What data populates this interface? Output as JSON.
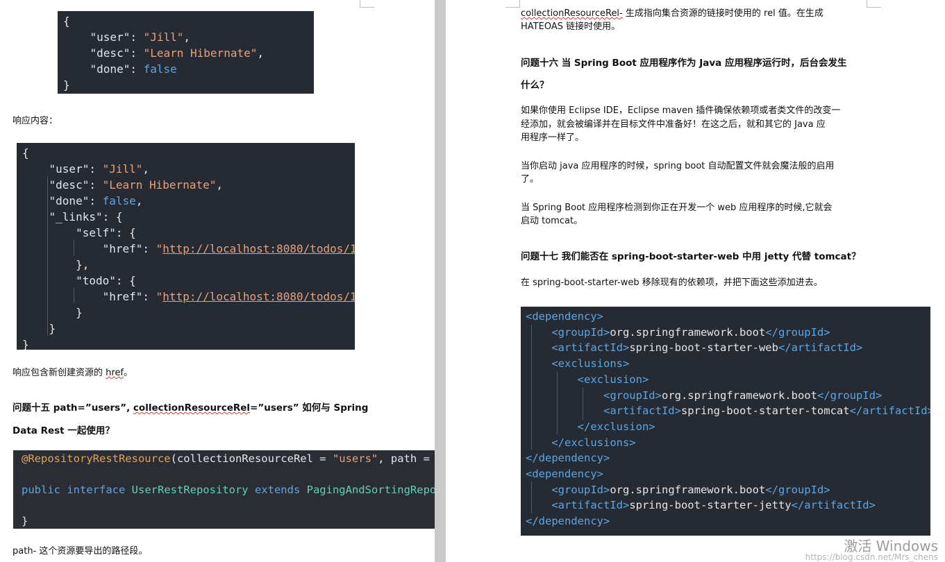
{
  "left": {
    "code1_lines": [
      [
        {
          "t": "{",
          "c": "plain"
        }
      ],
      [
        {
          "t": "    ",
          "c": "plain"
        },
        {
          "t": "\"user\"",
          "c": "key"
        },
        {
          "t": ": ",
          "c": "plain"
        },
        {
          "t": "\"Jill\"",
          "c": "str"
        },
        {
          "t": ",",
          "c": "plain"
        }
      ],
      [
        {
          "t": "    ",
          "c": "plain"
        },
        {
          "t": "\"desc\"",
          "c": "key"
        },
        {
          "t": ": ",
          "c": "plain"
        },
        {
          "t": "\"Learn Hibernate\"",
          "c": "str"
        },
        {
          "t": ",",
          "c": "plain"
        }
      ],
      [
        {
          "t": "    ",
          "c": "plain"
        },
        {
          "t": "\"done\"",
          "c": "key"
        },
        {
          "t": ": ",
          "c": "plain"
        },
        {
          "t": "false",
          "c": "kw"
        }
      ],
      [
        {
          "t": "}",
          "c": "plain"
        }
      ]
    ],
    "response_label": "响应内容：",
    "code2_lines": [
      [
        {
          "t": "{",
          "c": "plain"
        }
      ],
      [
        {
          "t": "    ",
          "c": "plain"
        },
        {
          "t": "\"user\"",
          "c": "key"
        },
        {
          "t": ": ",
          "c": "plain"
        },
        {
          "t": "\"Jill\"",
          "c": "str"
        },
        {
          "t": ",",
          "c": "plain"
        }
      ],
      [
        {
          "t": "    ",
          "c": "plain"
        },
        {
          "t": "\"desc\"",
          "c": "key"
        },
        {
          "t": ": ",
          "c": "plain"
        },
        {
          "t": "\"Learn Hibernate\"",
          "c": "str"
        },
        {
          "t": ",",
          "c": "plain"
        }
      ],
      [
        {
          "t": "    ",
          "c": "plain"
        },
        {
          "t": "\"done\"",
          "c": "key"
        },
        {
          "t": ": ",
          "c": "plain"
        },
        {
          "t": "false",
          "c": "kw"
        },
        {
          "t": ",",
          "c": "plain"
        }
      ],
      [
        {
          "t": "    ",
          "c": "plain"
        },
        {
          "t": "\"_links\"",
          "c": "key"
        },
        {
          "t": ": {",
          "c": "plain"
        }
      ],
      [
        {
          "t": "        ",
          "c": "plain"
        },
        {
          "t": "\"self\"",
          "c": "key"
        },
        {
          "t": ": {",
          "c": "plain"
        }
      ],
      [
        {
          "t": "            ",
          "c": "plain"
        },
        {
          "t": "\"href\"",
          "c": "key"
        },
        {
          "t": ": ",
          "c": "plain"
        },
        {
          "t": "\"",
          "c": "str"
        },
        {
          "t": "http://localhost:8080/todos/1",
          "c": "url"
        },
        {
          "t": "\"",
          "c": "str"
        }
      ],
      [
        {
          "t": "        },",
          "c": "plain"
        }
      ],
      [
        {
          "t": "        ",
          "c": "plain"
        },
        {
          "t": "\"todo\"",
          "c": "key"
        },
        {
          "t": ": {",
          "c": "plain"
        }
      ],
      [
        {
          "t": "            ",
          "c": "plain"
        },
        {
          "t": "\"href\"",
          "c": "key"
        },
        {
          "t": ": ",
          "c": "plain"
        },
        {
          "t": "\"",
          "c": "str"
        },
        {
          "t": "http://localhost:8080/todos/1",
          "c": "url"
        },
        {
          "t": "\"",
          "c": "str"
        }
      ],
      [
        {
          "t": "        }",
          "c": "plain"
        }
      ],
      [
        {
          "t": "    }",
          "c": "plain"
        }
      ],
      [
        {
          "t": "}",
          "c": "plain"
        }
      ]
    ],
    "href_note_prefix": "响应包含新创建资源的 ",
    "href_note_link": "href",
    "href_note_suffix": "。",
    "q15_part1": "问题十五  path=”users”, ",
    "q15_squig": "collectionResourceRel",
    "q15_part2": "=”users”  如何与  Spring",
    "q15_line2": "Data Rest 一起使用？",
    "code3_lines": [
      [
        {
          "t": "@RepositoryRestResource",
          "c": "ann"
        },
        {
          "t": "(collectionResourceRel = ",
          "c": "plain"
        },
        {
          "t": "\"users\"",
          "c": "str"
        },
        {
          "t": ", path = ",
          "c": "plain"
        },
        {
          "t": "\"",
          "c": "str"
        }
      ],
      [
        {
          "t": "",
          "c": "plain"
        }
      ],
      [
        {
          "t": "public ",
          "c": "kw"
        },
        {
          "t": "interface ",
          "c": "kw"
        },
        {
          "t": "UserRestRepository ",
          "c": "cls"
        },
        {
          "t": "extends ",
          "c": "kw"
        },
        {
          "t": "PagingAndSortingRepos",
          "c": "cls"
        }
      ],
      [
        {
          "t": "",
          "c": "plain"
        }
      ],
      [
        {
          "t": "}",
          "c": "plain"
        }
      ]
    ],
    "path_note": "path- 这个资源要导出的路径段。"
  },
  "right": {
    "top_squig": "collectionResourceRel-",
    "top_line1_rest": " 生成指向集合资源的链接时使用的 rel 值。在生成",
    "top_line2": "HATEOAS 链接时使用。",
    "q16_line1": "问题十六  当  Spring Boot 应用程序作为  Java 应用程序运行时，后台会发生",
    "q16_line2": "什么？",
    "para1_lines": [
      "如果你使用 Eclipse IDE，Eclipse maven 插件确保依赖项或者类文件的改变一",
      "经添加，就会被编译并在目标文件中准备好！在这之后，就和其它的 Java 应",
      "用程序一样了。"
    ],
    "para2_lines": [
      "当你启动 java 应用程序的时候，spring boot 自动配置文件就会魔法般的启用",
      "了。"
    ],
    "para3_lines": [
      "当 Spring Boot 应用程序检测到你正在开发一个 web 应用程序的时候,它就会",
      "启动 tomcat。"
    ],
    "q17": "问题十七  我们能否在  spring-boot-starter-web 中用  jetty 代替  tomcat？",
    "para4": "在 spring-boot-starter-web 移除现有的依赖项，并把下面这些添加进去。",
    "xml_lines": [
      [
        {
          "t": "<dependency>",
          "c": "tag"
        }
      ],
      [
        {
          "t": "    ",
          "c": "plain"
        },
        {
          "t": "<groupId>",
          "c": "tag"
        },
        {
          "t": "org.springframework.boot",
          "c": "txt"
        },
        {
          "t": "</groupId>",
          "c": "tag"
        }
      ],
      [
        {
          "t": "    ",
          "c": "plain"
        },
        {
          "t": "<artifactId>",
          "c": "tag"
        },
        {
          "t": "spring-boot-starter-web",
          "c": "txt"
        },
        {
          "t": "</artifactId>",
          "c": "tag"
        }
      ],
      [
        {
          "t": "    ",
          "c": "plain"
        },
        {
          "t": "<exclusions>",
          "c": "tag"
        }
      ],
      [
        {
          "t": "        ",
          "c": "plain"
        },
        {
          "t": "<exclusion>",
          "c": "tag"
        }
      ],
      [
        {
          "t": "            ",
          "c": "plain"
        },
        {
          "t": "<groupId>",
          "c": "tag"
        },
        {
          "t": "org.springframework.boot",
          "c": "txt"
        },
        {
          "t": "</groupId>",
          "c": "tag"
        }
      ],
      [
        {
          "t": "            ",
          "c": "plain"
        },
        {
          "t": "<artifactId>",
          "c": "tag"
        },
        {
          "t": "spring-boot-starter-tomcat",
          "c": "txt"
        },
        {
          "t": "</artifactId>",
          "c": "tag"
        }
      ],
      [
        {
          "t": "        ",
          "c": "plain"
        },
        {
          "t": "</exclusion>",
          "c": "tag"
        }
      ],
      [
        {
          "t": "    ",
          "c": "plain"
        },
        {
          "t": "</exclusions>",
          "c": "tag"
        }
      ],
      [
        {
          "t": "</dependency>",
          "c": "tag"
        }
      ],
      [
        {
          "t": "<dependency>",
          "c": "tag"
        }
      ],
      [
        {
          "t": "    ",
          "c": "plain"
        },
        {
          "t": "<groupId>",
          "c": "tag"
        },
        {
          "t": "org.springframework.boot",
          "c": "txt"
        },
        {
          "t": "</groupId>",
          "c": "tag"
        }
      ],
      [
        {
          "t": "    ",
          "c": "plain"
        },
        {
          "t": "<artifactId>",
          "c": "tag"
        },
        {
          "t": "spring-boot-starter-jetty",
          "c": "txt"
        },
        {
          "t": "</artifactId>",
          "c": "tag"
        }
      ],
      [
        {
          "t": "</dependency>",
          "c": "tag"
        }
      ]
    ],
    "watermark": "激活 Windows",
    "watermark_sub": "https://blog.csdn.net/Mrs_chens"
  }
}
